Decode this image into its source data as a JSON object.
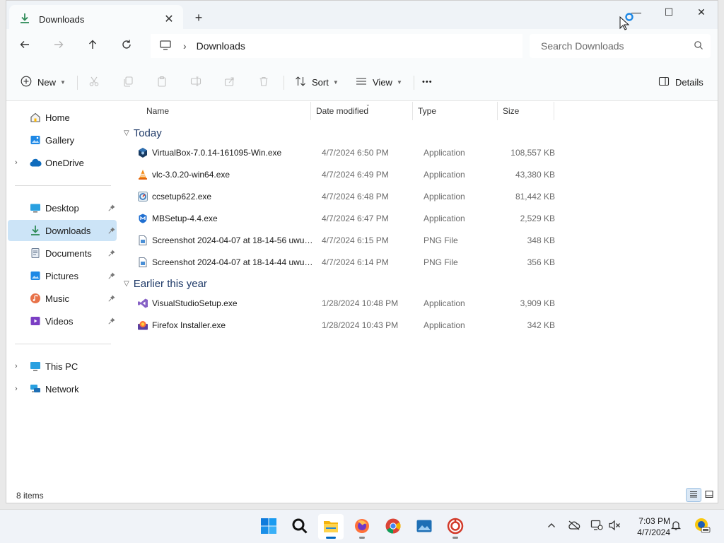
{
  "window": {
    "tab_title": "Downloads",
    "close_tab": "✕",
    "new_tab": "+"
  },
  "window_controls": {
    "minimize": "—",
    "maximize": "☐",
    "close": "✕"
  },
  "navigation": {
    "breadcrumb_separator": "›",
    "breadcrumb": [
      "Downloads"
    ],
    "search_placeholder": "Search Downloads"
  },
  "toolbar": {
    "new_label": "New",
    "sort_label": "Sort",
    "view_label": "View",
    "more_label": "•••",
    "details_label": "Details"
  },
  "sidebar": {
    "items": [
      {
        "label": "Home",
        "icon": "home-icon"
      },
      {
        "label": "Gallery",
        "icon": "gallery-icon"
      },
      {
        "label": "OneDrive",
        "icon": "cloud-icon",
        "expandable": true
      },
      {
        "label": "Desktop",
        "icon": "desktop-icon",
        "pinned": true
      },
      {
        "label": "Downloads",
        "icon": "download-icon",
        "pinned": true,
        "selected": true
      },
      {
        "label": "Documents",
        "icon": "documents-icon",
        "pinned": true
      },
      {
        "label": "Pictures",
        "icon": "pictures-icon",
        "pinned": true
      },
      {
        "label": "Music",
        "icon": "music-icon",
        "pinned": true
      },
      {
        "label": "Videos",
        "icon": "videos-icon",
        "pinned": true
      },
      {
        "label": "This PC",
        "icon": "computer-icon",
        "expandable": true
      },
      {
        "label": "Network",
        "icon": "network-icon",
        "expandable": true
      }
    ]
  },
  "columns": {
    "name": "Name",
    "date": "Date modified",
    "type": "Type",
    "size": "Size"
  },
  "groups": [
    {
      "title": "Today",
      "files": [
        {
          "name": "VirtualBox-7.0.14-161095-Win.exe",
          "date": "4/7/2024 6:50 PM",
          "type": "Application",
          "size": "108,557 KB",
          "icon": "virtualbox-icon"
        },
        {
          "name": "vlc-3.0.20-win64.exe",
          "date": "4/7/2024 6:49 PM",
          "type": "Application",
          "size": "43,380 KB",
          "icon": "vlc-icon"
        },
        {
          "name": "ccsetup622.exe",
          "date": "4/7/2024 6:48 PM",
          "type": "Application",
          "size": "81,442 KB",
          "icon": "ccleaner-icon"
        },
        {
          "name": "MBSetup-4.4.exe",
          "date": "4/7/2024 6:47 PM",
          "type": "Application",
          "size": "2,529 KB",
          "icon": "malwarebytes-icon"
        },
        {
          "name": "Screenshot 2024-04-07 at 18-14-56 uwuc...",
          "date": "4/7/2024 6:15 PM",
          "type": "PNG File",
          "size": "348 KB",
          "icon": "png-file-icon"
        },
        {
          "name": "Screenshot 2024-04-07 at 18-14-44 uwuc...",
          "date": "4/7/2024 6:14 PM",
          "type": "PNG File",
          "size": "356 KB",
          "icon": "png-file-icon"
        }
      ]
    },
    {
      "title": "Earlier this year",
      "files": [
        {
          "name": "VisualStudioSetup.exe",
          "date": "1/28/2024 10:48 PM",
          "type": "Application",
          "size": "3,909 KB",
          "icon": "visual-studio-icon"
        },
        {
          "name": "Firefox Installer.exe",
          "date": "1/28/2024 10:43 PM",
          "type": "Application",
          "size": "342 KB",
          "icon": "firefox-installer-icon"
        }
      ]
    }
  ],
  "status": {
    "item_count": "8 items"
  },
  "taskbar": {
    "apps": [
      "start-icon",
      "search-icon",
      "file-explorer-icon",
      "firefox-icon",
      "chrome-icon",
      "photos-icon",
      "app-icon"
    ],
    "time": "7:03 PM",
    "date": "4/7/2024"
  },
  "colors": {
    "accent": "#0067c0",
    "selection": "#cce4f7",
    "group_header": "#1f3a68"
  }
}
